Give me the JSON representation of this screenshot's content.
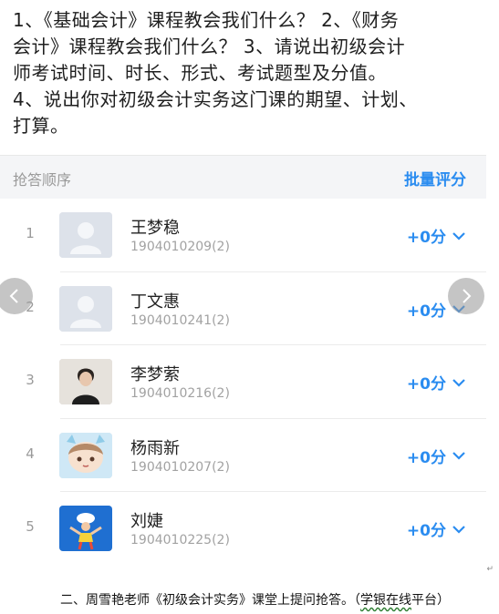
{
  "question": {
    "line1": "1、《基础会计》课程教会我们什么？ 2、《财务",
    "line2": "会计》课程教会我们什么？ 3、请说出初级会计",
    "line3": "师考试时间、时长、形式、考试题型及分值。",
    "line4": "4、说出你对初级会计实务这门课的期望、计划、",
    "line5": "打算。"
  },
  "header": {
    "order_label": "抢答顺序",
    "batch_label": "批量评分"
  },
  "students": [
    {
      "rank": "1",
      "name": "王梦稳",
      "id": "1904010209(2)",
      "score": "+0分",
      "avatar": "default-avatar-icon"
    },
    {
      "rank": "2",
      "name": "丁文惠",
      "id": "1904010241(2)",
      "score": "+0分",
      "avatar": "default-avatar-icon"
    },
    {
      "rank": "3",
      "name": "李梦萦",
      "id": "1904010216(2)",
      "score": "+0分",
      "avatar": "photo-avatar"
    },
    {
      "rank": "4",
      "name": "杨雨新",
      "id": "1904010207(2)",
      "score": "+0分",
      "avatar": "cartoon-avatar"
    },
    {
      "rank": "5",
      "name": "刘婕",
      "id": "1904010225(2)",
      "score": "+0分",
      "avatar": "illustration-avatar"
    }
  ],
  "caption": {
    "main": "二、周雪艳老师《初级会计实务》课堂上提问抢答。（",
    "underlined": "学银在线",
    "tail": "平台）"
  },
  "return_mark": "↵",
  "colors": {
    "accent": "#2a8cf0",
    "header_bg": "#f4f5f7",
    "muted": "#9a9a9a"
  }
}
